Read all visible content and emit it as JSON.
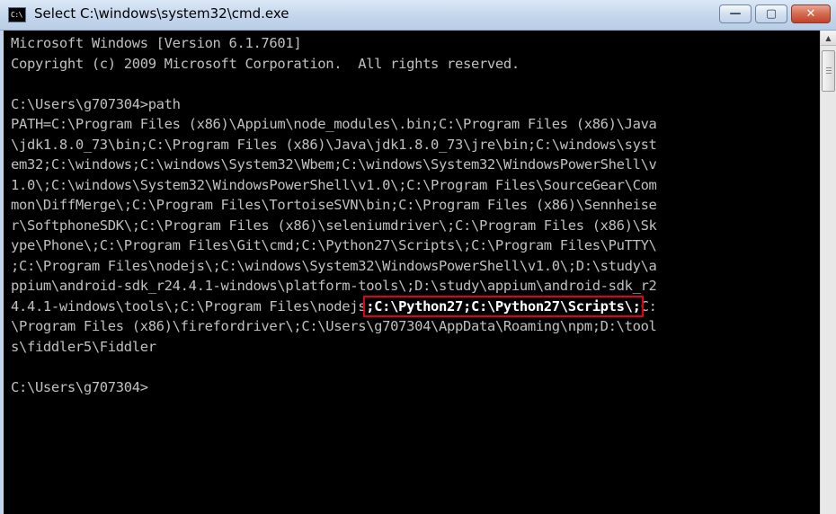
{
  "window": {
    "title": "Select C:\\windows\\system32\\cmd.exe",
    "icon_label": "C:\\",
    "minimize_glyph": "—",
    "maximize_glyph": "▢",
    "close_glyph": "✕"
  },
  "console": {
    "lines": [
      "Microsoft Windows [Version 6.1.7601]",
      "Copyright (c) 2009 Microsoft Corporation.  All rights reserved.",
      "",
      "C:\\Users\\g707304>path",
      "PATH=C:\\Program Files (x86)\\Appium\\node_modules\\.bin;C:\\Program Files (x86)\\Java",
      "\\jdk1.8.0_73\\bin;C:\\Program Files (x86)\\Java\\jdk1.8.0_73\\jre\\bin;C:\\windows\\syst",
      "em32;C:\\windows;C:\\windows\\System32\\Wbem;C:\\windows\\System32\\WindowsPowerShell\\v",
      "1.0\\;C:\\windows\\System32\\WindowsPowerShell\\v1.0\\;C:\\Program Files\\SourceGear\\Com",
      "mon\\DiffMerge\\;C:\\Program Files\\TortoiseSVN\\bin;C:\\Program Files (x86)\\Sennheise",
      "r\\SoftphoneSDK\\;C:\\Program Files (x86)\\seleniumdriver\\;C:\\Program Files (x86)\\Sk",
      "ype\\Phone\\;C:\\Program Files\\Git\\cmd;C:\\Python27\\Scripts\\;C:\\Program Files\\PuTTY\\",
      ";C:\\Program Files\\nodejs\\;C:\\windows\\System32\\WindowsPowerShell\\v1.0\\;D:\\study\\a",
      "ppium\\android-sdk_r24.4.1-windows\\platform-tools\\;D:\\study\\appium\\android-sdk_r2"
    ],
    "hl_line_before": "4.4.1-windows\\tools\\;C:\\Program Files\\nodejs",
    "hl_text": ";C:\\Python27;C:\\Python27\\Scripts\\;",
    "hl_line_after": "C:",
    "lines_after": [
      "\\Program Files (x86)\\firefordriver\\;C:\\Users\\g707304\\AppData\\Roaming\\npm;D:\\tool",
      "s\\fiddler5\\Fiddler",
      "",
      "C:\\Users\\g707304>"
    ]
  },
  "colors": {
    "console_bg": "#000000",
    "console_fg": "#c0c0c0",
    "highlight_border": "#e0001a"
  }
}
